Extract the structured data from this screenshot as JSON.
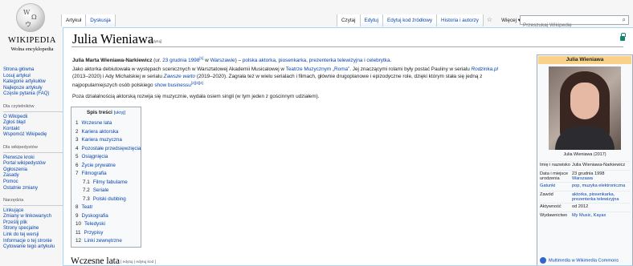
{
  "logo": {
    "wordmark": "WIKIPEDIA",
    "tagline": "Wolna encyklopedia"
  },
  "sidebar": {
    "main": [
      "Strona główna",
      "Losuj artykuł",
      "Kategorie artykułów",
      "Najlepsze artykuły",
      "Częste pytania (FAQ)"
    ],
    "readers_header": "Dla czytelników",
    "readers": [
      "O Wikipedii",
      "Zgłoś błąd",
      "Kontakt",
      "Wspomóż Wikipedię"
    ],
    "editors_header": "Dla wikipedystów",
    "editors": [
      "Pierwsze kroki",
      "Portal wikipedystów",
      "Ogłoszenia",
      "Zasady",
      "Pomoc",
      "Ostatnie zmiany"
    ],
    "tools_header": "Narzędzia",
    "tools": [
      "Linkujące",
      "Zmiany w linkowanych",
      "Prześlij plik",
      "Strony specjalne",
      "Link do tej wersji",
      "Informacje o tej stronie",
      "Cytowanie tego artykułu"
    ]
  },
  "tabs": {
    "left": [
      "Artykuł",
      "Dyskusja"
    ],
    "right": [
      "Czytaj",
      "Edytuj",
      "Edytuj kod źródłowy",
      "Historia i autorzy"
    ],
    "more": "Więcej"
  },
  "search": {
    "placeholder": "Przeszukaj Wikipedię"
  },
  "article": {
    "title": "Julia Wieniawa",
    "title_edit": "[edytuj]",
    "p1": {
      "name": "Julia Marta Wieniawa-Narkiewicz",
      "born_pre": " (ur. ",
      "born_date": "23 grudnia 1998",
      "ref": "[1]",
      "in": " w ",
      "city": "Warszawie",
      "rest_pre": ") – ",
      "l1": "polska aktorka",
      "c1": ", ",
      "l2": "piosenkarka",
      "c2": ", ",
      "l3": "prezenterka telewizyjna",
      "c3": " i ",
      "l4": "celebrytka",
      "end": "."
    },
    "p2_line1_pre": "Jako aktorka debiutowała w występach scenicznych w Warsztatowej Akademii Musicalowej w ",
    "p2_link1": "Teatrze Muzycznym „Roma”",
    "p2_line1_mid": ". Jej znaczącymi rolami były postać Pauliny w serialu ",
    "p2_link2": "Rodzinka.pl",
    "p2_line2_pre": "(2013–2020) i Ady Michalskiej w serialu ",
    "p2_link3": "Zawsze warto",
    "p2_line2_post": " (2019–2020). Zagrała też w wielu serialach i filmach, głównie drugoplanowe i epizodyczne role, dzięki którym stała się jedną z",
    "p2_line3_pre": "najpopularniejszych osób polskiego ",
    "p2_link4": "show businessu",
    "p2_refs": "[2][3][4]",
    "p3": "Poza działalnością aktorską rozwija się muzycznie, wydała osiem singli (w tym jeden z gościnnym udziałem).",
    "section_heading": "Wczesne lata",
    "section_edit": "[ edytuj | edytuj kod ]"
  },
  "toc": {
    "title": "Spis treści",
    "hide": "[ukryj]",
    "items": [
      {
        "num": "1",
        "label": "Wczesne lata"
      },
      {
        "num": "2",
        "label": "Kariera aktorska"
      },
      {
        "num": "3",
        "label": "Kariera muzyczna"
      },
      {
        "num": "4",
        "label": "Pozostałe przedsięwzięcia"
      },
      {
        "num": "5",
        "label": "Osiągnięcia"
      },
      {
        "num": "6",
        "label": "Życie prywatne"
      },
      {
        "num": "7",
        "label": "Filmografia"
      },
      {
        "num": "7.1",
        "label": "Filmy fabularne"
      },
      {
        "num": "7.2",
        "label": "Seriale"
      },
      {
        "num": "7.3",
        "label": "Polski dubbing"
      },
      {
        "num": "8",
        "label": "Teatr"
      },
      {
        "num": "9",
        "label": "Dyskografia"
      },
      {
        "num": "10",
        "label": "Teledyski"
      },
      {
        "num": "11",
        "label": "Przypisy"
      },
      {
        "num": "12",
        "label": "Linki zewnętrzne"
      }
    ]
  },
  "infobox": {
    "title": "Julia Wieniawa",
    "caption": "Julia Wieniawa (2017)",
    "rows": [
      {
        "label": "Imię i nazwisko",
        "value": "Julia Wieniawa-Narkiewicz",
        "link": false
      },
      {
        "label": "Data i miejsce urodzenia",
        "value": "23 grudnia 1998",
        "value2": "Warszawa",
        "link": false
      },
      {
        "label": "Gatunki",
        "value": "pop, muzyka elektroniczna",
        "link": true
      },
      {
        "label": "Zawód",
        "value": "aktorka, piosenkarka, prezenterka telewizyjna",
        "link": true
      },
      {
        "label": "Aktywność",
        "value": "od 2012",
        "link": false
      },
      {
        "label": "Wydawnictwo",
        "value": "My Music, Kayax",
        "link": true
      }
    ],
    "commons": "Multimedia w Wikimedia Commons"
  },
  "colors": {
    "link": "#0645ad",
    "infobox_header": "#f8d288"
  }
}
